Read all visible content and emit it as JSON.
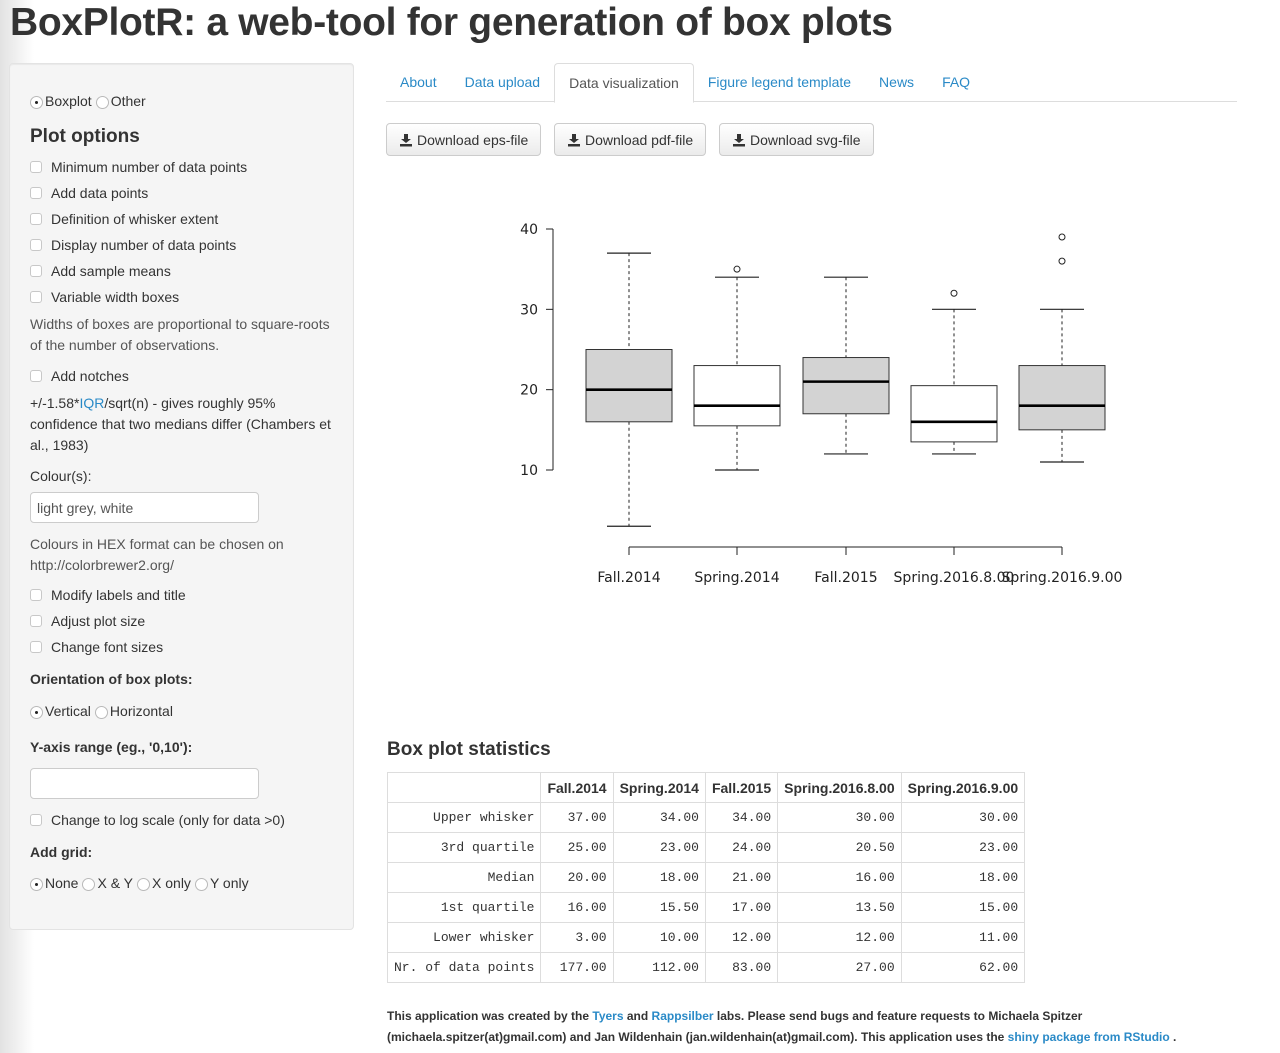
{
  "page": {
    "title": "BoxPlotR: a web-tool for generation of box plots"
  },
  "sidebar": {
    "plot_type": {
      "options": [
        "Boxplot",
        "Other"
      ],
      "selected": "Boxplot"
    },
    "plot_options_title": "Plot options",
    "checkboxes_top": [
      {
        "label": "Minimum number of data points",
        "checked": false
      },
      {
        "label": "Add data points",
        "checked": false
      },
      {
        "label": "Definition of whisker extent",
        "checked": false
      },
      {
        "label": "Display number of data points",
        "checked": false
      },
      {
        "label": "Add sample means",
        "checked": false
      },
      {
        "label": "Variable width boxes",
        "checked": false
      }
    ],
    "variable_width_help": "Widths of boxes are proportional to square-roots of the number of observations.",
    "notches": {
      "label": "Add notches",
      "checked": false
    },
    "notches_help": {
      "prefix": "+/-1.58*",
      "link": "IQR",
      "suffix": "/sqrt(n) - gives roughly 95% confidence that two medians differ (Chambers et al., 1983)"
    },
    "colours_label": "Colour(s):",
    "colours_value": "light grey, white",
    "colours_help": "Colours in HEX format can be chosen on http://colorbrewer2.org/",
    "checkboxes_bottom": [
      {
        "label": "Modify labels and title",
        "checked": false
      },
      {
        "label": "Adjust plot size",
        "checked": false
      },
      {
        "label": "Change font sizes",
        "checked": false
      }
    ],
    "orientation_label": "Orientation of box plots:",
    "orientation": {
      "options": [
        "Vertical",
        "Horizontal"
      ],
      "selected": "Vertical"
    },
    "yrange_label": "Y-axis range (eg., '0,10'):",
    "yrange_value": "",
    "log_scale": {
      "label": "Change to log scale (only for data >0)",
      "checked": false
    },
    "grid_label": "Add grid:",
    "grid": {
      "options": [
        "None",
        "X & Y",
        "X only",
        "Y only"
      ],
      "selected": "None"
    }
  },
  "tabs": [
    {
      "label": "About",
      "active": false
    },
    {
      "label": "Data upload",
      "active": false
    },
    {
      "label": "Data visualization",
      "active": true
    },
    {
      "label": "Figure legend template",
      "active": false
    },
    {
      "label": "News",
      "active": false
    },
    {
      "label": "FAQ",
      "active": false
    }
  ],
  "downloads": [
    "Download eps-file",
    "Download pdf-file",
    "Download svg-file"
  ],
  "colors": {
    "link": "#2a8ac7",
    "box_grey": "#d3d3d3",
    "box_white": "#ffffff"
  },
  "chart_data": {
    "type": "box",
    "title": "",
    "xlabel": "",
    "ylabel": "",
    "ylim": [
      3,
      40
    ],
    "yticks": [
      10,
      20,
      30,
      40
    ],
    "grid": false,
    "categories": [
      "Fall.2014",
      "Spring.2014",
      "Fall.2015",
      "Spring.2016.8.00",
      "Spring.2016.9.00"
    ],
    "box_fills": [
      "#d3d3d3",
      "#ffffff",
      "#d3d3d3",
      "#ffffff",
      "#d3d3d3"
    ],
    "upper_whisker": [
      37,
      34,
      34,
      30,
      30
    ],
    "q3": [
      25,
      23,
      24,
      20.5,
      23
    ],
    "median": [
      20,
      18,
      21,
      16,
      18
    ],
    "q1": [
      16,
      15.5,
      17,
      13.5,
      15
    ],
    "lower_whisker": [
      3,
      10,
      12,
      12,
      11
    ],
    "n": [
      177,
      112,
      83,
      27,
      62
    ],
    "outliers": [
      [],
      [
        35
      ],
      [],
      [
        32
      ],
      [
        36,
        39
      ]
    ]
  },
  "stats": {
    "title": "Box plot statistics",
    "columns": [
      "",
      "Fall.2014",
      "Spring.2014",
      "Fall.2015",
      "Spring.2016.8.00",
      "Spring.2016.9.00"
    ],
    "rows": [
      [
        "Upper whisker",
        "37.00",
        "34.00",
        "34.00",
        "30.00",
        "30.00"
      ],
      [
        "3rd quartile",
        "25.00",
        "23.00",
        "24.00",
        "20.50",
        "23.00"
      ],
      [
        "Median",
        "20.00",
        "18.00",
        "21.00",
        "16.00",
        "18.00"
      ],
      [
        "1st quartile",
        "16.00",
        "15.50",
        "17.00",
        "13.50",
        "15.00"
      ],
      [
        "Lower whisker",
        "3.00",
        "10.00",
        "12.00",
        "12.00",
        "11.00"
      ],
      [
        "Nr. of data points",
        "177.00",
        "112.00",
        "83.00",
        "27.00",
        "62.00"
      ]
    ]
  },
  "footer": {
    "t1": "This application was created by the ",
    "link1": "Tyers",
    "t2": " and ",
    "link2": "Rappsilber",
    "t3": " labs. Please send bugs and feature requests to Michaela Spitzer (michaela.spitzer(at)gmail.com) and Jan Wildenhain (jan.wildenhain(at)gmail.com). This application uses the ",
    "link3": "shiny package from RStudio",
    "t4": " ."
  }
}
